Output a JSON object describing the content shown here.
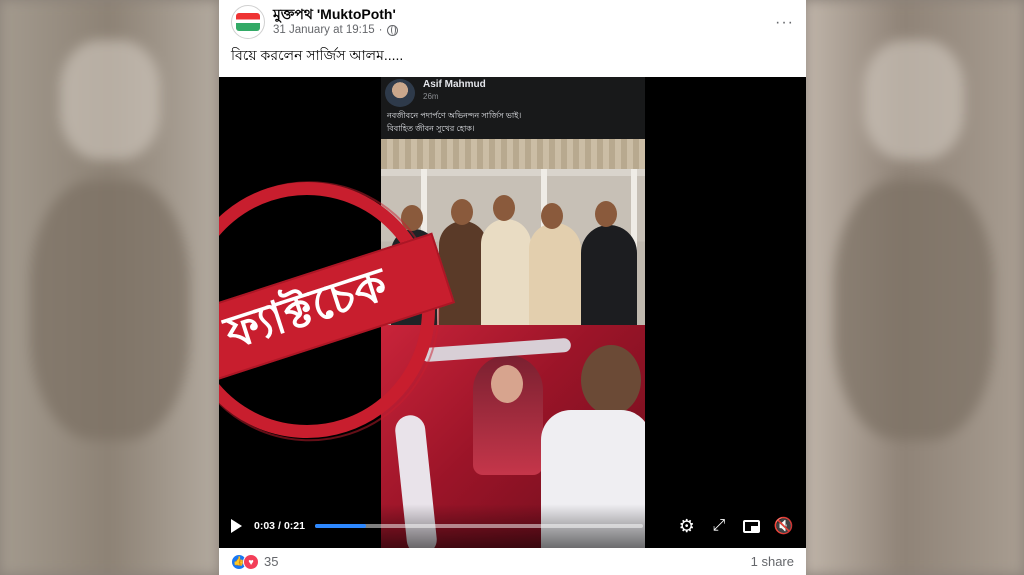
{
  "post": {
    "page_name": "মুক্তপথ 'MuktoPoth'",
    "date": "31 January at 19:15",
    "more_icon": "···",
    "caption": "বিয়ে করলেন সার্জিস আলম....."
  },
  "embedded_post": {
    "author": "Asif Mahmud",
    "time": "26m",
    "line1": "নবজীবনে পদার্পণে অভিনন্দন সার্জিস ভাই।",
    "line2": "বিবাহিত জীবন সুখের হোক।"
  },
  "stamp": {
    "text": "ফ্যাক্টচেক",
    "color": "#c81e2e"
  },
  "video_controls": {
    "current_time": "0:03",
    "separator": "/",
    "duration": "0:21",
    "progress_fraction": 0.155,
    "icons": [
      "play-icon",
      "settings-icon",
      "expand-icon",
      "picture-in-picture-icon",
      "volume-muted-icon"
    ],
    "accent": "#2d88ff"
  },
  "footer": {
    "reactions": [
      "like",
      "love"
    ],
    "reaction_count": "35",
    "shares": "1 share"
  }
}
